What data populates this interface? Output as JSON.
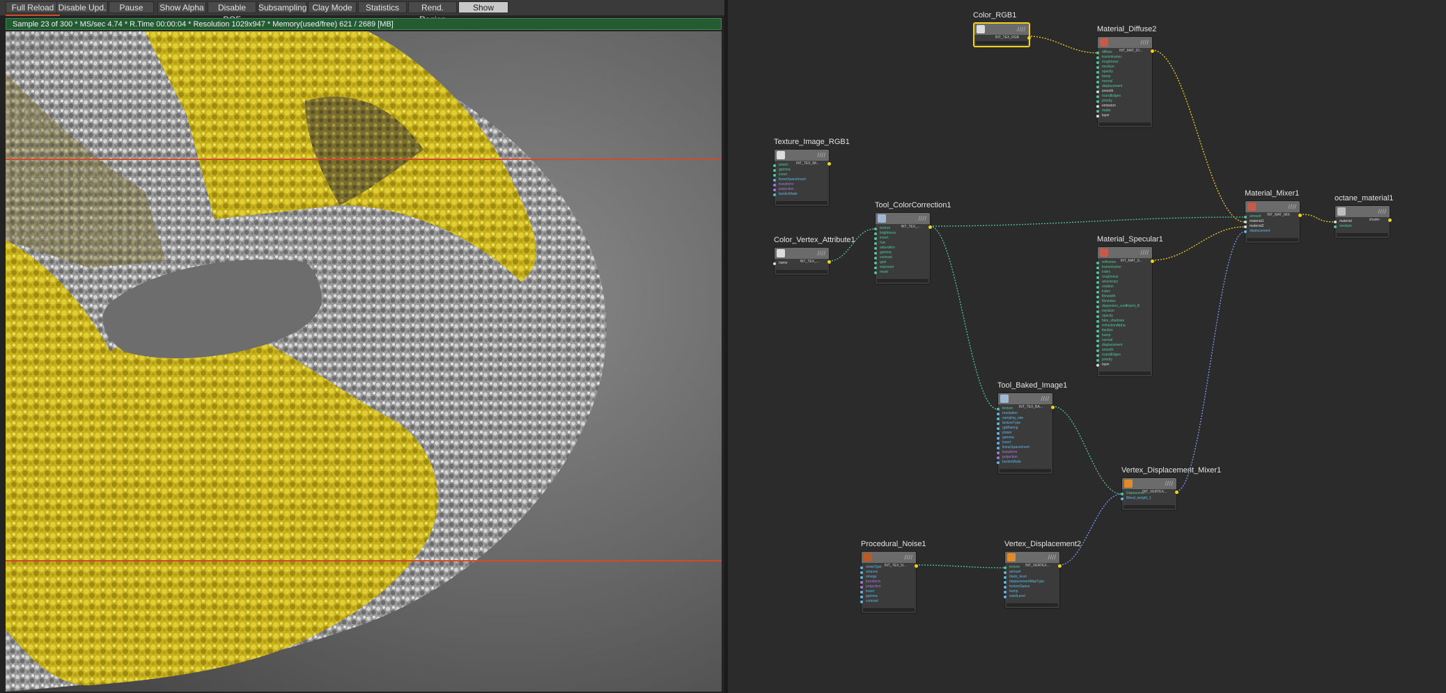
{
  "toolbar": {
    "buttons": [
      {
        "label": "Full Reload",
        "active": false
      },
      {
        "label": "Disable Upd.",
        "active": false
      },
      {
        "label": "Pause",
        "active": false
      },
      {
        "label": "Show Alpha",
        "active": false
      },
      {
        "label": "Disable DOF",
        "active": false
      },
      {
        "label": "Subsampling",
        "active": false
      },
      {
        "label": "Clay Mode",
        "active": false
      },
      {
        "label": "Statistics",
        "active": false
      },
      {
        "label": "Rend. Region",
        "active": false
      },
      {
        "label": "Show Denoise",
        "active": true
      }
    ]
  },
  "status": {
    "text": "Sample 23 of 300 * MS/sec 4.74 * R.Time 00:00:04 * Resolution 1029x947 * Memory(used/free) 621 / 2689 [MB]"
  },
  "colors": {
    "accent_selected": "#f2d21d",
    "status_bg": "#245b33",
    "region_line": "#d34a2a",
    "graph_bg": "#2b2b2b",
    "node_bg": "#3b3b3b",
    "port_green": "#4fc79a",
    "port_cyan": "#5bb8e6",
    "port_purple": "#a67ad9",
    "port_white": "#dcdcdc",
    "link_yellow": "#f2d21d",
    "link_teal": "#4fc7a8",
    "link_blue": "#7f9cf0"
  },
  "graph": {
    "nodes": [
      {
        "id": "color_rgb1",
        "title": "Color_RGB1",
        "icon": "checker-icon",
        "icon_color": "#dddddd",
        "output": "INT_TEX_RGB",
        "selected": true,
        "ports": []
      },
      {
        "id": "material_diffuse2",
        "title": "Material_Diffuse2",
        "icon": "material-sphere-icon",
        "icon_color": "#c85a4a",
        "output": "INT_MAT_DI...",
        "selected": false,
        "ports": [
          [
            "diffuse",
            "g"
          ],
          [
            "transmission",
            "g"
          ],
          [
            "roughness",
            "g"
          ],
          [
            "medium",
            "g"
          ],
          [
            "opacity",
            "g"
          ],
          [
            "bump",
            "g"
          ],
          [
            "normal",
            "g"
          ],
          [
            "displacement",
            "g"
          ],
          [
            "smooth",
            "w"
          ],
          [
            "roundEdges",
            "g"
          ],
          [
            "priority",
            "g"
          ],
          [
            "emission",
            "w"
          ],
          [
            "matte",
            "g"
          ],
          [
            "layer",
            "w"
          ]
        ]
      },
      {
        "id": "texture_image_rgb1",
        "title": "Texture_Image_RGB1",
        "icon": "checker-icon",
        "icon_color": "#dddddd",
        "output": "INT_TEX_IM...",
        "selected": false,
        "ports": [
          [
            "power",
            "g"
          ],
          [
            "gamma",
            "g"
          ],
          [
            "invert",
            "g"
          ],
          [
            "linearSpaceInvert",
            "c"
          ],
          [
            "transform",
            "p"
          ],
          [
            "projection",
            "p"
          ],
          [
            "borderMode",
            "c"
          ]
        ]
      },
      {
        "id": "tool_colorcorrection1",
        "title": "Tool_ColorCorrection1",
        "icon": "globe-icon",
        "icon_color": "#9fb8d6",
        "output": "INT_TEX_...",
        "selected": false,
        "ports": [
          [
            "texture",
            "g"
          ],
          [
            "brightness",
            "g"
          ],
          [
            "invert",
            "g"
          ],
          [
            "hue",
            "g"
          ],
          [
            "saturation",
            "g"
          ],
          [
            "gamma",
            "g"
          ],
          [
            "contrast",
            "g"
          ],
          [
            "gain",
            "g"
          ],
          [
            "exposure",
            "g"
          ],
          [
            "mask",
            "g"
          ]
        ]
      },
      {
        "id": "color_vertex_attribute1",
        "title": "Color_Vertex_Attribute1",
        "icon": "checker-icon",
        "icon_color": "#dddddd",
        "output": "INT_TEX_...",
        "selected": false,
        "ports": [
          [
            "name",
            "w"
          ]
        ]
      },
      {
        "id": "material_mixer1",
        "title": "Material_Mixer1",
        "icon": "material-sphere-icon",
        "icon_color": "#c85a4a",
        "output": "INT_MAT_MIX",
        "selected": false,
        "ports": [
          [
            "amount",
            "g"
          ],
          [
            "material1",
            "w"
          ],
          [
            "material2",
            "w"
          ],
          [
            "displacement",
            "c"
          ]
        ]
      },
      {
        "id": "octane_material1",
        "title": "octane_material1",
        "icon": "material-output-icon",
        "icon_color": "#bcbcbc",
        "output": "shader",
        "selected": false,
        "ports": [
          [
            "material",
            "w"
          ],
          [
            "medium",
            "g"
          ]
        ]
      },
      {
        "id": "material_specular1",
        "title": "Material_Specular1",
        "icon": "material-sphere-icon",
        "icon_color": "#c85a4a",
        "output": "INT_MAT_S...",
        "selected": false,
        "ports": [
          [
            "reflection",
            "g"
          ],
          [
            "transmission",
            "g"
          ],
          [
            "index",
            "g"
          ],
          [
            "roughness",
            "g"
          ],
          [
            "anisotropy",
            "g"
          ],
          [
            "rotation",
            "g"
          ],
          [
            "index",
            "g"
          ],
          [
            "filmwidth",
            "g"
          ],
          [
            "filmindex",
            "g"
          ],
          [
            "dispersion_coefficient_B",
            "g"
          ],
          [
            "medium",
            "g"
          ],
          [
            "opacity",
            "g"
          ],
          [
            "fake_shadows",
            "g"
          ],
          [
            "refractionAlpha",
            "g"
          ],
          [
            "thinfilm",
            "g"
          ],
          [
            "bump",
            "g"
          ],
          [
            "normal",
            "g"
          ],
          [
            "displacement",
            "g"
          ],
          [
            "smooth",
            "g"
          ],
          [
            "roundEdges",
            "g"
          ],
          [
            "priority",
            "g"
          ],
          [
            "layer",
            "w"
          ]
        ]
      },
      {
        "id": "tool_baked_image1",
        "title": "Tool_Baked_Image1",
        "icon": "globe-icon",
        "icon_color": "#9fb8d6",
        "output": "INT_TEX_BA...",
        "selected": false,
        "ports": [
          [
            "texture",
            "g"
          ],
          [
            "resolution",
            "c"
          ],
          [
            "samplng_rate",
            "c"
          ],
          [
            "textureType",
            "c"
          ],
          [
            "rgbBaking",
            "c"
          ],
          [
            "power",
            "c"
          ],
          [
            "gamma",
            "c"
          ],
          [
            "invert",
            "c"
          ],
          [
            "linearSpaceInvert",
            "c"
          ],
          [
            "transform",
            "p"
          ],
          [
            "projection",
            "p"
          ],
          [
            "borderMode",
            "c"
          ]
        ]
      },
      {
        "id": "vertex_displacement_mixer1",
        "title": "Vertex_Displacement_Mixer1",
        "icon": "displacement-icon",
        "icon_color": "#e08a2a",
        "output": "INT_VERTEX...",
        "selected": false,
        "ports": [
          [
            "Displaceme...",
            "g"
          ],
          [
            "Blend_weight_1",
            "c"
          ]
        ]
      },
      {
        "id": "procedural_noise1",
        "title": "Procedural_Noise1",
        "icon": "noise-swatch-icon",
        "icon_color": "#b85a2a",
        "output": "INT_TEX_N...",
        "selected": false,
        "ports": [
          [
            "noiseType",
            "c"
          ],
          [
            "octaves",
            "c"
          ],
          [
            "omega",
            "c"
          ],
          [
            "transform",
            "p"
          ],
          [
            "projection",
            "p"
          ],
          [
            "invert",
            "c"
          ],
          [
            "gamma",
            "c"
          ],
          [
            "contrast",
            "c"
          ]
        ]
      },
      {
        "id": "vertex_displacement2",
        "title": "Vertex_Displacement2",
        "icon": "displacement-icon",
        "icon_color": "#e08a2a",
        "output": "INT_VERTEX...",
        "selected": false,
        "ports": [
          [
            "texture",
            "g"
          ],
          [
            "amount",
            "c"
          ],
          [
            "black_level",
            "c"
          ],
          [
            "displacementMapType",
            "c"
          ],
          [
            "textureSpace",
            "c"
          ],
          [
            "bump",
            "c"
          ],
          [
            "subdLevel",
            "c"
          ]
        ]
      }
    ]
  }
}
